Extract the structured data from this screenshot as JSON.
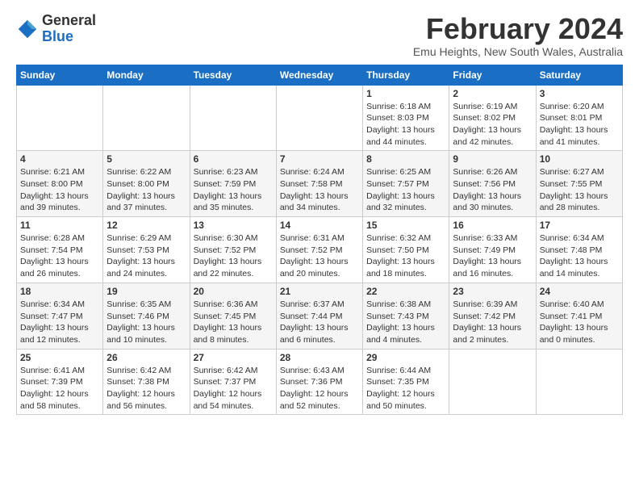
{
  "header": {
    "logo_general": "General",
    "logo_blue": "Blue",
    "month_title": "February 2024",
    "subtitle": "Emu Heights, New South Wales, Australia"
  },
  "days_of_week": [
    "Sunday",
    "Monday",
    "Tuesday",
    "Wednesday",
    "Thursday",
    "Friday",
    "Saturday"
  ],
  "weeks": [
    [
      {
        "day": "",
        "details": ""
      },
      {
        "day": "",
        "details": ""
      },
      {
        "day": "",
        "details": ""
      },
      {
        "day": "",
        "details": ""
      },
      {
        "day": "1",
        "details": "Sunrise: 6:18 AM\nSunset: 8:03 PM\nDaylight: 13 hours\nand 44 minutes."
      },
      {
        "day": "2",
        "details": "Sunrise: 6:19 AM\nSunset: 8:02 PM\nDaylight: 13 hours\nand 42 minutes."
      },
      {
        "day": "3",
        "details": "Sunrise: 6:20 AM\nSunset: 8:01 PM\nDaylight: 13 hours\nand 41 minutes."
      }
    ],
    [
      {
        "day": "4",
        "details": "Sunrise: 6:21 AM\nSunset: 8:00 PM\nDaylight: 13 hours\nand 39 minutes."
      },
      {
        "day": "5",
        "details": "Sunrise: 6:22 AM\nSunset: 8:00 PM\nDaylight: 13 hours\nand 37 minutes."
      },
      {
        "day": "6",
        "details": "Sunrise: 6:23 AM\nSunset: 7:59 PM\nDaylight: 13 hours\nand 35 minutes."
      },
      {
        "day": "7",
        "details": "Sunrise: 6:24 AM\nSunset: 7:58 PM\nDaylight: 13 hours\nand 34 minutes."
      },
      {
        "day": "8",
        "details": "Sunrise: 6:25 AM\nSunset: 7:57 PM\nDaylight: 13 hours\nand 32 minutes."
      },
      {
        "day": "9",
        "details": "Sunrise: 6:26 AM\nSunset: 7:56 PM\nDaylight: 13 hours\nand 30 minutes."
      },
      {
        "day": "10",
        "details": "Sunrise: 6:27 AM\nSunset: 7:55 PM\nDaylight: 13 hours\nand 28 minutes."
      }
    ],
    [
      {
        "day": "11",
        "details": "Sunrise: 6:28 AM\nSunset: 7:54 PM\nDaylight: 13 hours\nand 26 minutes."
      },
      {
        "day": "12",
        "details": "Sunrise: 6:29 AM\nSunset: 7:53 PM\nDaylight: 13 hours\nand 24 minutes."
      },
      {
        "day": "13",
        "details": "Sunrise: 6:30 AM\nSunset: 7:52 PM\nDaylight: 13 hours\nand 22 minutes."
      },
      {
        "day": "14",
        "details": "Sunrise: 6:31 AM\nSunset: 7:52 PM\nDaylight: 13 hours\nand 20 minutes."
      },
      {
        "day": "15",
        "details": "Sunrise: 6:32 AM\nSunset: 7:50 PM\nDaylight: 13 hours\nand 18 minutes."
      },
      {
        "day": "16",
        "details": "Sunrise: 6:33 AM\nSunset: 7:49 PM\nDaylight: 13 hours\nand 16 minutes."
      },
      {
        "day": "17",
        "details": "Sunrise: 6:34 AM\nSunset: 7:48 PM\nDaylight: 13 hours\nand 14 minutes."
      }
    ],
    [
      {
        "day": "18",
        "details": "Sunrise: 6:34 AM\nSunset: 7:47 PM\nDaylight: 13 hours\nand 12 minutes."
      },
      {
        "day": "19",
        "details": "Sunrise: 6:35 AM\nSunset: 7:46 PM\nDaylight: 13 hours\nand 10 minutes."
      },
      {
        "day": "20",
        "details": "Sunrise: 6:36 AM\nSunset: 7:45 PM\nDaylight: 13 hours\nand 8 minutes."
      },
      {
        "day": "21",
        "details": "Sunrise: 6:37 AM\nSunset: 7:44 PM\nDaylight: 13 hours\nand 6 minutes."
      },
      {
        "day": "22",
        "details": "Sunrise: 6:38 AM\nSunset: 7:43 PM\nDaylight: 13 hours\nand 4 minutes."
      },
      {
        "day": "23",
        "details": "Sunrise: 6:39 AM\nSunset: 7:42 PM\nDaylight: 13 hours\nand 2 minutes."
      },
      {
        "day": "24",
        "details": "Sunrise: 6:40 AM\nSunset: 7:41 PM\nDaylight: 13 hours\nand 0 minutes."
      }
    ],
    [
      {
        "day": "25",
        "details": "Sunrise: 6:41 AM\nSunset: 7:39 PM\nDaylight: 12 hours\nand 58 minutes."
      },
      {
        "day": "26",
        "details": "Sunrise: 6:42 AM\nSunset: 7:38 PM\nDaylight: 12 hours\nand 56 minutes."
      },
      {
        "day": "27",
        "details": "Sunrise: 6:42 AM\nSunset: 7:37 PM\nDaylight: 12 hours\nand 54 minutes."
      },
      {
        "day": "28",
        "details": "Sunrise: 6:43 AM\nSunset: 7:36 PM\nDaylight: 12 hours\nand 52 minutes."
      },
      {
        "day": "29",
        "details": "Sunrise: 6:44 AM\nSunset: 7:35 PM\nDaylight: 12 hours\nand 50 minutes."
      },
      {
        "day": "",
        "details": ""
      },
      {
        "day": "",
        "details": ""
      }
    ]
  ]
}
